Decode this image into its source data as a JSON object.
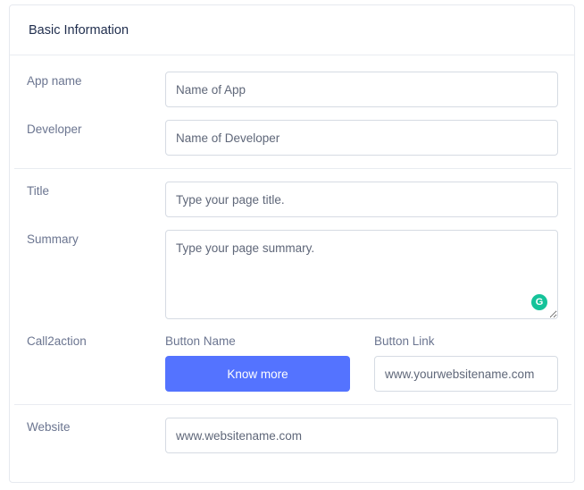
{
  "header": {
    "title": "Basic Information"
  },
  "app_name": {
    "label": "App name",
    "placeholder": "Name of App"
  },
  "developer": {
    "label": "Developer",
    "placeholder": "Name of Developer"
  },
  "title": {
    "label": "Title",
    "placeholder": "Type your page title."
  },
  "summary": {
    "label": "Summary",
    "placeholder": "Type your page summary.",
    "grammarly_icon": "grammarly-icon",
    "grammarly_glyph": "G"
  },
  "call2action": {
    "label": "Call2action",
    "button_name_label": "Button Name",
    "button_text": "Know more",
    "button_link_label": "Button Link",
    "button_link_placeholder": "www.yourwebsitename.com"
  },
  "website": {
    "label": "Website",
    "placeholder": "www.websitename.com"
  },
  "colors": {
    "accent": "#5473ff",
    "grammarly": "#15c39a",
    "border": "#d6dbe3"
  }
}
